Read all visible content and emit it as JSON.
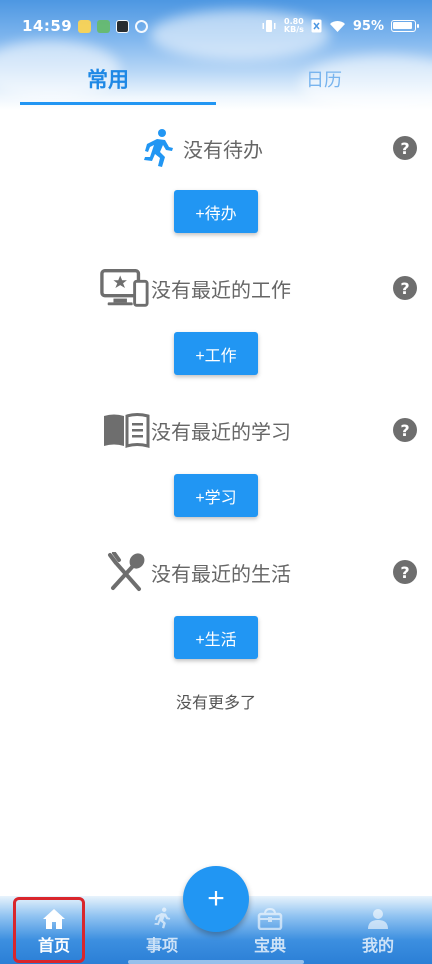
{
  "status_bar": {
    "time": "14:59",
    "net_speed_value": "0.80",
    "net_speed_unit": "KB/s",
    "battery": "95%"
  },
  "tabs": [
    {
      "label": "常用",
      "active": true
    },
    {
      "label": "日历",
      "active": false
    }
  ],
  "sections": [
    {
      "icon": "running-person-icon",
      "title": "没有待办",
      "button": "+待办"
    },
    {
      "icon": "work-monitor-icon",
      "title": "没有最近的工作",
      "button": "+工作"
    },
    {
      "icon": "book-icon",
      "title": "没有最近的学习",
      "button": "+学习"
    },
    {
      "icon": "fork-spoon-icon",
      "title": "没有最近的生活",
      "button": "+生活"
    }
  ],
  "no_more": "没有更多了",
  "fab_label": "+",
  "bottom_nav": [
    {
      "label": "首页",
      "icon": "home-icon",
      "selected": true
    },
    {
      "label": "事项",
      "icon": "running-person-icon",
      "selected": false
    },
    {
      "label": "宝典",
      "icon": "treasure-box-icon",
      "selected": false
    },
    {
      "label": "我的",
      "icon": "person-icon",
      "selected": false
    }
  ],
  "colors": {
    "accent": "#2196f3",
    "highlight": "#d9262c",
    "title_text": "#666666",
    "icon_gray": "#6e6e6e"
  }
}
